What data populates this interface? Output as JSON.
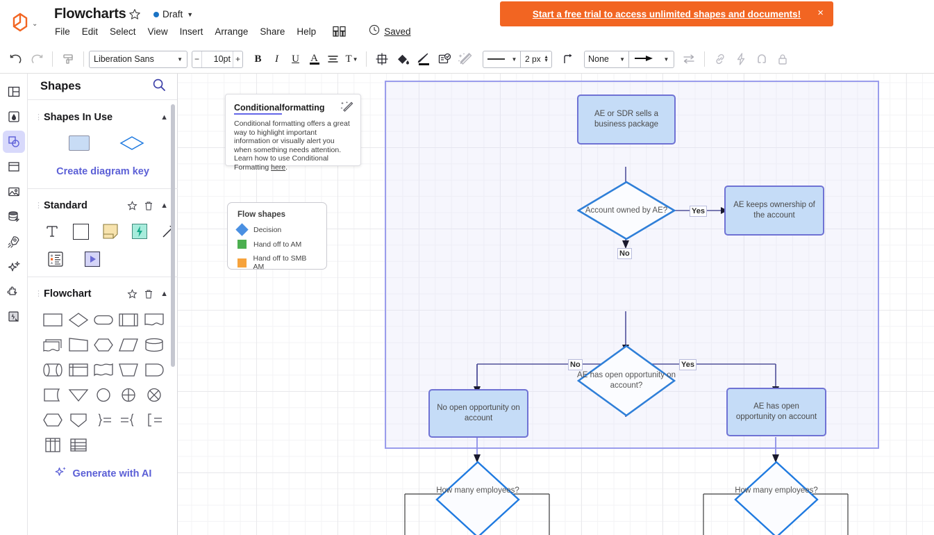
{
  "app": {
    "title": "Flowcharts",
    "status": "Draft",
    "status_color": "#1a73c4",
    "saved_label": "Saved",
    "logo_caret": "⌄"
  },
  "banner": {
    "text": "Start a free trial to access unlimited shapes and documents!",
    "close": "×",
    "bg": "#f26522"
  },
  "menu": {
    "items": [
      {
        "label": "File"
      },
      {
        "label": "Edit"
      },
      {
        "label": "Select"
      },
      {
        "label": "View"
      },
      {
        "label": "Insert"
      },
      {
        "label": "Arrange"
      },
      {
        "label": "Share"
      },
      {
        "label": "Help"
      }
    ]
  },
  "toolbar": {
    "undo": "undo-icon",
    "redo": "redo-icon",
    "format_painter": "format-painter-icon",
    "font_family": "Liberation Sans",
    "font_size": "10pt",
    "size_minus": "−",
    "size_plus": "+",
    "bold": "B",
    "italic": "I",
    "underline": "U",
    "text_color": "A",
    "align": "align-icon",
    "text_options": "T",
    "line_width": "2 px",
    "line_style": "solid",
    "start_arrow": "None",
    "end_arrow": "arrow",
    "caret": "▾"
  },
  "rail": {
    "items": [
      {
        "name": "layout-icon"
      },
      {
        "name": "theme-icon"
      },
      {
        "name": "shapes-icon",
        "active": true
      },
      {
        "name": "templates-icon"
      },
      {
        "name": "image-icon"
      },
      {
        "name": "data-link-icon"
      },
      {
        "name": "rocket-icon"
      },
      {
        "name": "sparkle-icon"
      },
      {
        "name": "plugin-icon"
      },
      {
        "name": "automation-icon"
      }
    ]
  },
  "panel": {
    "title": "Shapes",
    "search_icon": "search-icon",
    "sections": [
      {
        "title": "Shapes In Use",
        "create_key": "Create diagram key",
        "shapes": [
          "rounded-rect-blue",
          "diamond-outline"
        ]
      },
      {
        "title": "Standard",
        "shapes": [
          "text-shape",
          "square-shape",
          "sticky-note-shape",
          "lightning-shape",
          "arrow-shape",
          "list-shape",
          "play-shape"
        ]
      },
      {
        "title": "Flowchart",
        "shapes": [
          "process",
          "decision",
          "terminator",
          "predefined-process",
          "document",
          "multi-document",
          "trapezoid-top",
          "preparation",
          "parallelogram",
          "database",
          "direct-data",
          "internal-storage",
          "wave-document",
          "manual-operation",
          "display",
          "stored-data",
          "merge",
          "connector-circle",
          "summing-junction",
          "or-gate",
          "delay",
          "extract",
          "brace-right",
          "brace-left",
          "bracket-left",
          "table-columns",
          "table-rows"
        ]
      }
    ],
    "generate_ai": "Generate with AI"
  },
  "tip_card": {
    "title_underlined": "Conditional",
    "title_plain": " formatting",
    "body": "Conditional formatting offers a great way to highlight important information or visually alert you when something needs attention. Learn how to use Conditional Formatting ",
    "link": "here",
    "body_end": ".",
    "icon": "magic-wand-icon"
  },
  "legend": {
    "title": "Flow shapes",
    "rows": [
      {
        "label": "Decision",
        "color": "#4a90e2",
        "shape": "diamond"
      },
      {
        "label": "Hand off to AM",
        "color": "#4caf50",
        "shape": "square"
      },
      {
        "label": "Hand off to SMB AM",
        "color": "#f6a33c",
        "shape": "square"
      }
    ]
  },
  "chart_data": {
    "type": "diagram",
    "title": "Flowcharts",
    "nodes": [
      {
        "id": "n1",
        "text": "AE or SDR sells a business package",
        "shape": "rect",
        "fill": "#c5dcf7",
        "stroke": "#6f72d4"
      },
      {
        "id": "n2",
        "text": "Account owned by AE?",
        "shape": "diamond",
        "fill": "#ffffff",
        "stroke": "#2f7fd8"
      },
      {
        "id": "n3",
        "text": "AE keeps ownership of the account",
        "shape": "rect",
        "fill": "#c5dcf7",
        "stroke": "#6f72d4"
      },
      {
        "id": "n4",
        "text": "AE has open opportunity on account?",
        "shape": "diamond",
        "fill": "#ffffff",
        "stroke": "#2f7fd8"
      },
      {
        "id": "n5",
        "text": "No open opportunity on account",
        "shape": "rect",
        "fill": "#c5dcf7",
        "stroke": "#6f72d4"
      },
      {
        "id": "n6",
        "text": "AE has open opportunity on account",
        "shape": "rect",
        "fill": "#c5dcf7",
        "stroke": "#6f72d4"
      },
      {
        "id": "n7",
        "text": "How many employees?",
        "shape": "diamond",
        "fill": "#ffffff",
        "stroke": "#1f7ae0"
      },
      {
        "id": "n8",
        "text": "How many employees?",
        "shape": "diamond",
        "fill": "#ffffff",
        "stroke": "#1f7ae0"
      }
    ],
    "edges": [
      {
        "from": "n1",
        "to": "n2",
        "label": ""
      },
      {
        "from": "n2",
        "to": "n3",
        "label": "Yes"
      },
      {
        "from": "n2",
        "to": "n4",
        "label": "No"
      },
      {
        "from": "n4",
        "to": "n5",
        "label": "No"
      },
      {
        "from": "n4",
        "to": "n6",
        "label": "Yes"
      },
      {
        "from": "n5",
        "to": "n7",
        "label": ""
      },
      {
        "from": "n6",
        "to": "n8",
        "label": ""
      }
    ]
  }
}
